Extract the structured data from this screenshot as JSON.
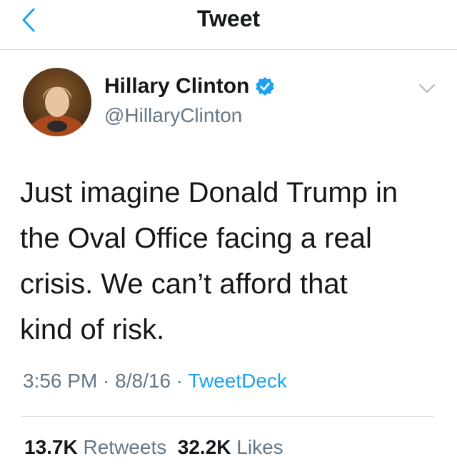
{
  "header": {
    "title": "Tweet",
    "back_icon": "chevron-left-icon",
    "accent": "#1da1f2"
  },
  "author": {
    "name": "Hillary Clinton",
    "handle": "@HillaryClinton",
    "verified": true,
    "verified_icon": "verified-badge-icon",
    "menu_icon": "chevron-down-icon"
  },
  "tweet": {
    "lines": [
      "Just imagine Donald Trump in",
      "the Oval Office facing a real",
      "crisis. We can’t afford that",
      "kind of risk."
    ],
    "time": "3:56 PM",
    "dot1": " · ",
    "date": "8/8/16",
    "dot2": " · ",
    "source": "TweetDeck"
  },
  "stats": {
    "retweets_count": "13.7K",
    "retweets_label": "Retweets",
    "likes_count": "32.2K",
    "likes_label": "Likes"
  },
  "colors": {
    "text": "#14171a",
    "muted": "#657786",
    "link": "#1da1f2",
    "divider": "#d9dde1"
  }
}
